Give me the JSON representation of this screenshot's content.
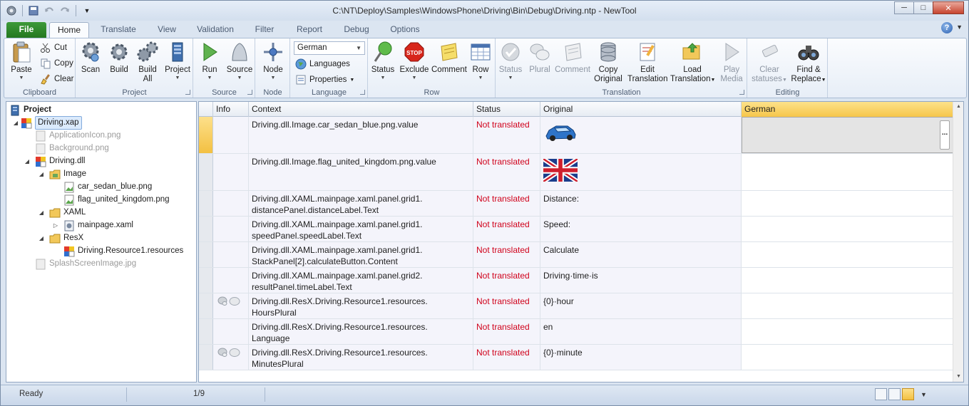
{
  "window": {
    "title": "C:\\NT\\Deploy\\Samples\\WindowsPhone\\Driving\\Bin\\Debug\\Driving.ntp - NewTool",
    "controls": [
      "─",
      "□",
      "✕"
    ]
  },
  "tabs": {
    "file": "File",
    "items": [
      "Home",
      "Translate",
      "View",
      "Validation",
      "Filter",
      "Report",
      "Debug",
      "Options"
    ],
    "help": "?"
  },
  "ribbon": {
    "clipboard": {
      "label": "Clipboard",
      "paste": "Paste",
      "cut": "Cut",
      "copy": "Copy",
      "clear": "Clear"
    },
    "project": {
      "label": "Project",
      "scan": "Scan",
      "build": "Build",
      "build_all": "Build All",
      "project": "Project"
    },
    "source": {
      "label": "Source",
      "run": "Run",
      "source": "Source"
    },
    "node": {
      "label": "Node",
      "node": "Node"
    },
    "language": {
      "label": "Language",
      "selected": "German",
      "languages": "Languages",
      "properties": "Properties"
    },
    "row": {
      "label": "Row",
      "status": "Status",
      "exclude": "Exclude",
      "comment": "Comment",
      "row": "Row"
    },
    "translation": {
      "label": "Translation",
      "status": "Status",
      "plural": "Plural",
      "comment": "Comment",
      "copy_original": "Copy Original",
      "edit_translation": "Edit Translation",
      "load_translation": "Load Translation",
      "play_media": "Play Media"
    },
    "editing": {
      "label": "Editing",
      "clear_statuses": "Clear statuses",
      "find_replace": "Find & Replace"
    }
  },
  "tree": {
    "root": "Project",
    "nodes": [
      {
        "label": "Driving.xap"
      },
      {
        "label": "ApplicationIcon.png"
      },
      {
        "label": "Background.png"
      },
      {
        "label": "Driving.dll"
      },
      {
        "label": "Image"
      },
      {
        "label": "car_sedan_blue.png"
      },
      {
        "label": "flag_united_kingdom.png"
      },
      {
        "label": "XAML"
      },
      {
        "label": "mainpage.xaml"
      },
      {
        "label": "ResX"
      },
      {
        "label": "Driving.Resource1.resources"
      },
      {
        "label": "SplashScreenImage.jpg"
      }
    ]
  },
  "grid": {
    "columns": [
      "Info",
      "Context",
      "Status",
      "Original",
      "German"
    ],
    "rows": [
      {
        "context": "Driving.dll.Image.car_sedan_blue.png.value",
        "status": "Not translated",
        "original": ""
      },
      {
        "context": "Driving.dll.Image.flag_united_kingdom.png.value",
        "status": "Not translated",
        "original": ""
      },
      {
        "context": "Driving.dll.XAML.mainpage.xaml.panel.grid1.\ndistancePanel.distanceLabel.Text",
        "status": "Not translated",
        "original": "Distance:"
      },
      {
        "context": "Driving.dll.XAML.mainpage.xaml.panel.grid1.\nspeedPanel.speedLabel.Text",
        "status": "Not translated",
        "original": "Speed:"
      },
      {
        "context": "Driving.dll.XAML.mainpage.xaml.panel.grid1.\nStackPanel[2].calculateButton.Content",
        "status": "Not translated",
        "original": "Calculate"
      },
      {
        "context": "Driving.dll.XAML.mainpage.xaml.panel.grid2.\nresultPanel.timeLabel.Text",
        "status": "Not translated",
        "original": "Driving·time·is"
      },
      {
        "context": "Driving.dll.ResX.Driving.Resource1.resources.\nHoursPlural",
        "status": "Not translated",
        "original": "{0}·hour"
      },
      {
        "context": "Driving.dll.ResX.Driving.Resource1.resources.\nLanguage",
        "status": "Not translated",
        "original": "en"
      },
      {
        "context": "Driving.dll.ResX.Driving.Resource1.resources.\nMinutesPlural",
        "status": "Not translated",
        "original": "{0}·minute"
      }
    ],
    "edit_button": "..."
  },
  "statusbar": {
    "state": "Ready",
    "position": "1/9"
  },
  "colors": {
    "not_translated": "#d0021b",
    "file_tab": "#2d8a29",
    "german_header": "#f6c64a"
  }
}
